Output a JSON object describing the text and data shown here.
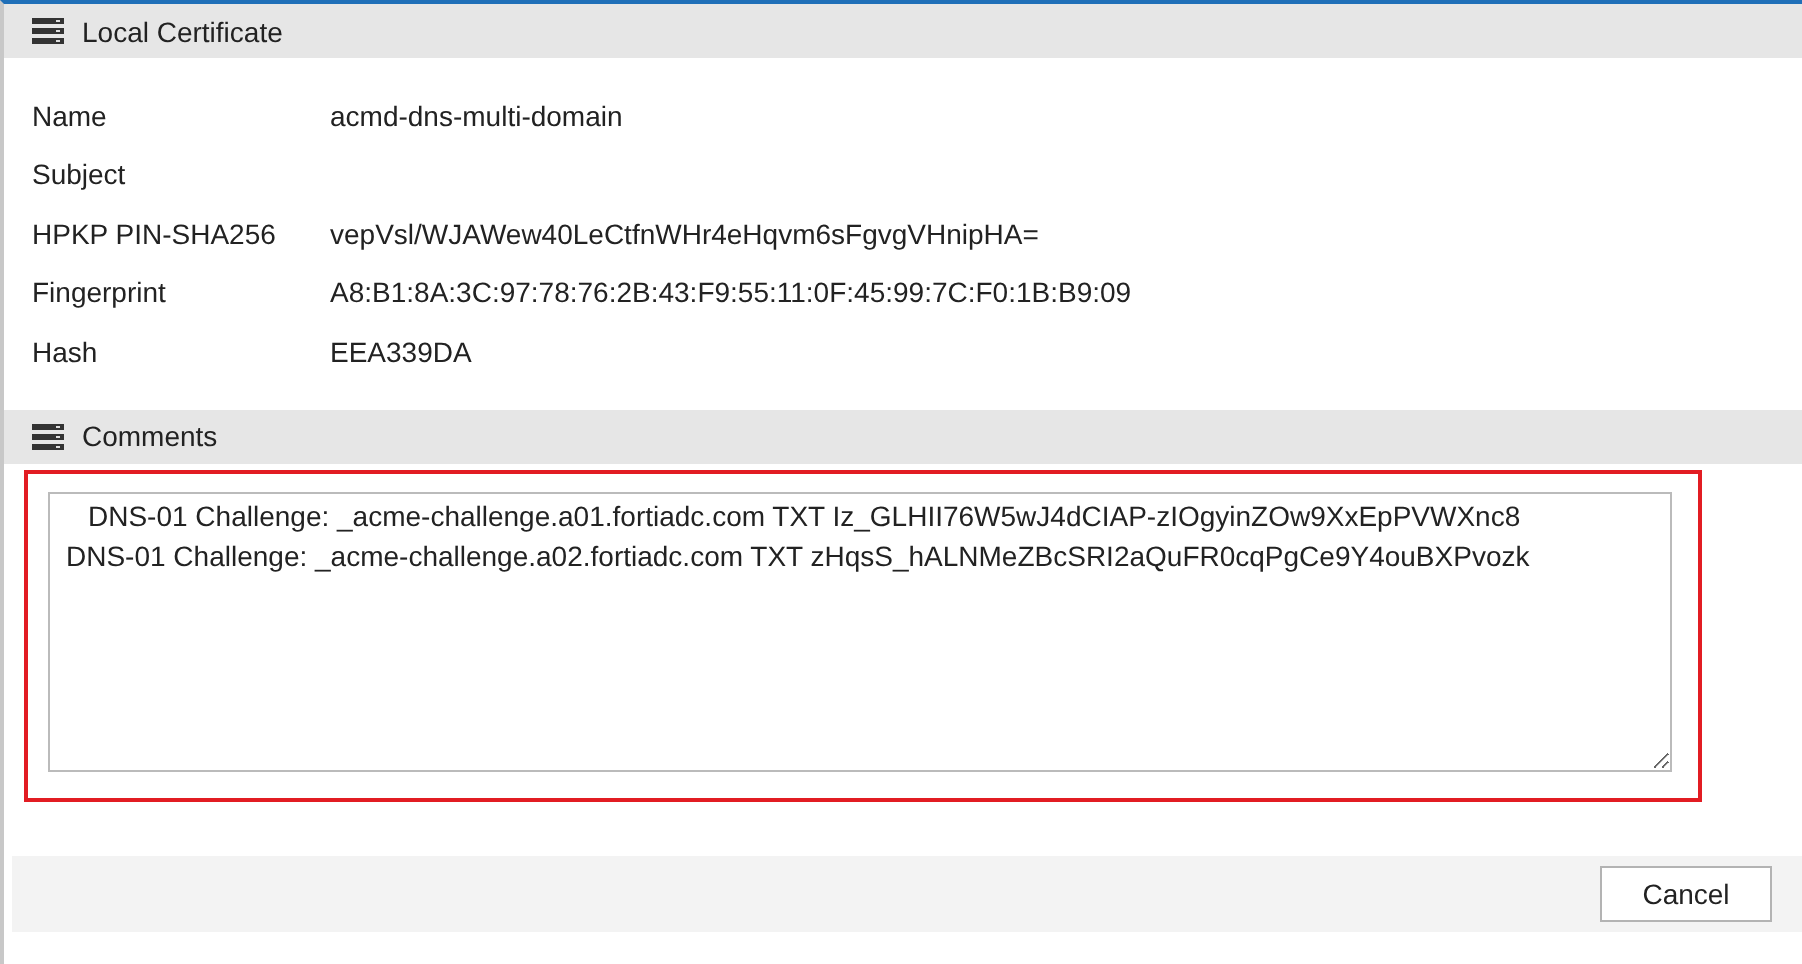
{
  "certificate_section": {
    "title": "Local Certificate"
  },
  "fields": [
    {
      "label": "Name",
      "value": "acmd-dns-multi-domain"
    },
    {
      "label": "Subject"
    },
    {
      "label": "HPKP PIN-SHA256",
      "value": "vepVsl/WJAWew40LeCtfnWHr4eHqvm6sFgvgVHnipHA="
    },
    {
      "label": "Fingerprint",
      "value": "A8:B1:8A:3C:97:78:76:2B:43:F9:55:11:0F:45:99:7C:F0:1B:B9:09"
    },
    {
      "label": "Hash",
      "value": "EEA339DA"
    }
  ],
  "comments_section": {
    "title": "Comments",
    "highlighted": true,
    "lines": [
      "DNS-01 Challenge: _acme-challenge.a01.fortiadc.com TXT Iz_GLHII76W5wJ4dCIAP-zIOgyinZOw9XxEpPVWXnc8",
      "DNS-01 Challenge: _acme-challenge.a02.fortiadc.com TXT zHqsS_hALNMeZBcSRI2aQuFR0cqPgCe9Y4ouBXPvozk"
    ]
  },
  "buttons": [
    {
      "label": "Cancel"
    }
  ]
}
